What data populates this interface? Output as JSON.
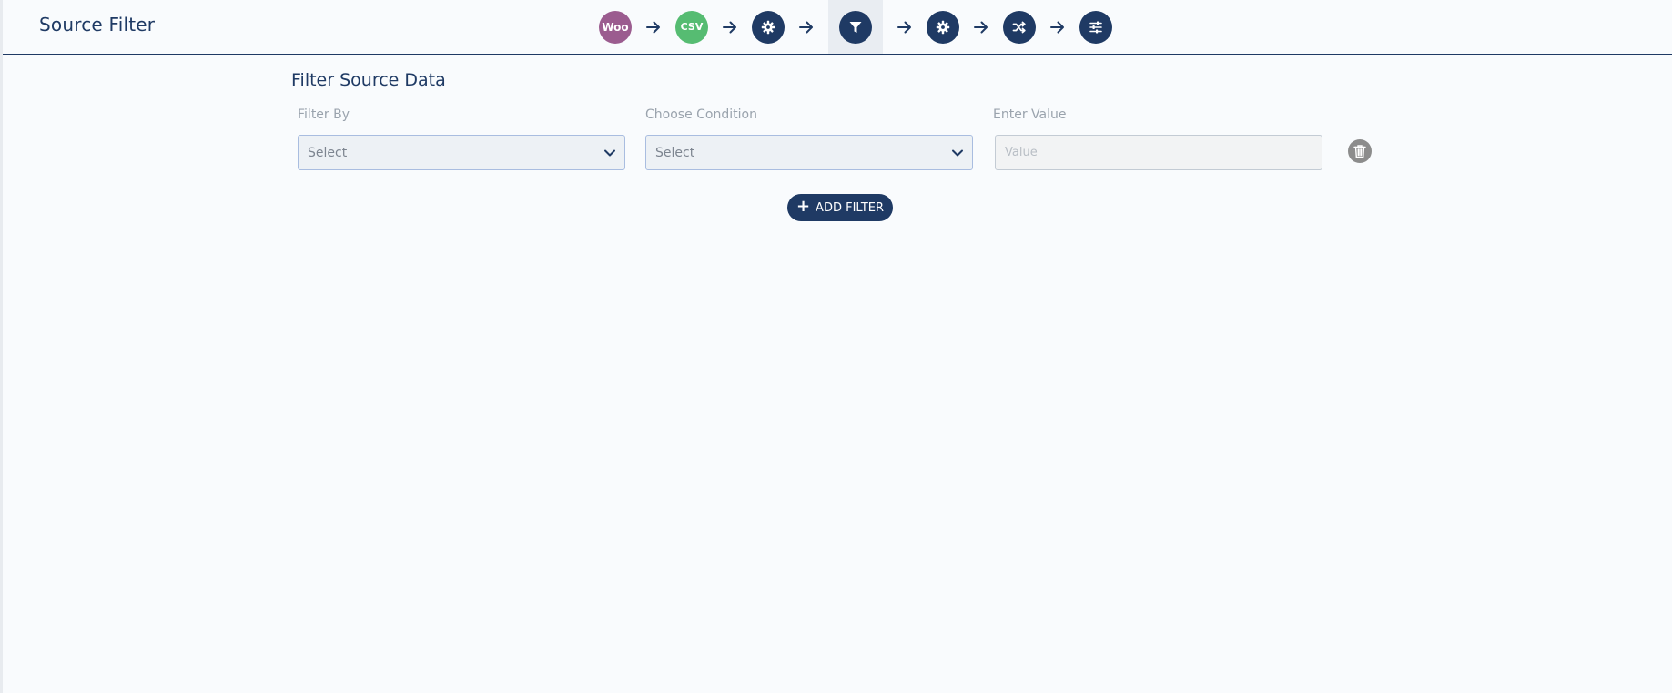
{
  "header": {
    "title": "Source Filter"
  },
  "steps": [
    {
      "name": "woocommerce",
      "label": "Woo",
      "color": "#9b5c8f"
    },
    {
      "name": "csv",
      "label": "CSV",
      "color": "#56bc72"
    },
    {
      "name": "settings",
      "icon": "gear-icon"
    },
    {
      "name": "filter",
      "icon": "filter-icon",
      "active": true
    },
    {
      "name": "settings-2",
      "icon": "gear-icon"
    },
    {
      "name": "shuffle",
      "icon": "shuffle-icon"
    },
    {
      "name": "sliders",
      "icon": "sliders-icon"
    }
  ],
  "main": {
    "section_title": "Filter Source Data",
    "filter_by_label": "Filter By",
    "filter_by_value": "Select",
    "condition_label": "Choose Condition",
    "condition_value": "Select",
    "value_label": "Enter Value",
    "value_placeholder": "Value",
    "add_filter_label": "ADD FILTER"
  },
  "colors": {
    "primary": "#1f3a64",
    "woo": "#9b5c8f",
    "csv": "#56bc72",
    "trash": "#8c8c8c"
  }
}
